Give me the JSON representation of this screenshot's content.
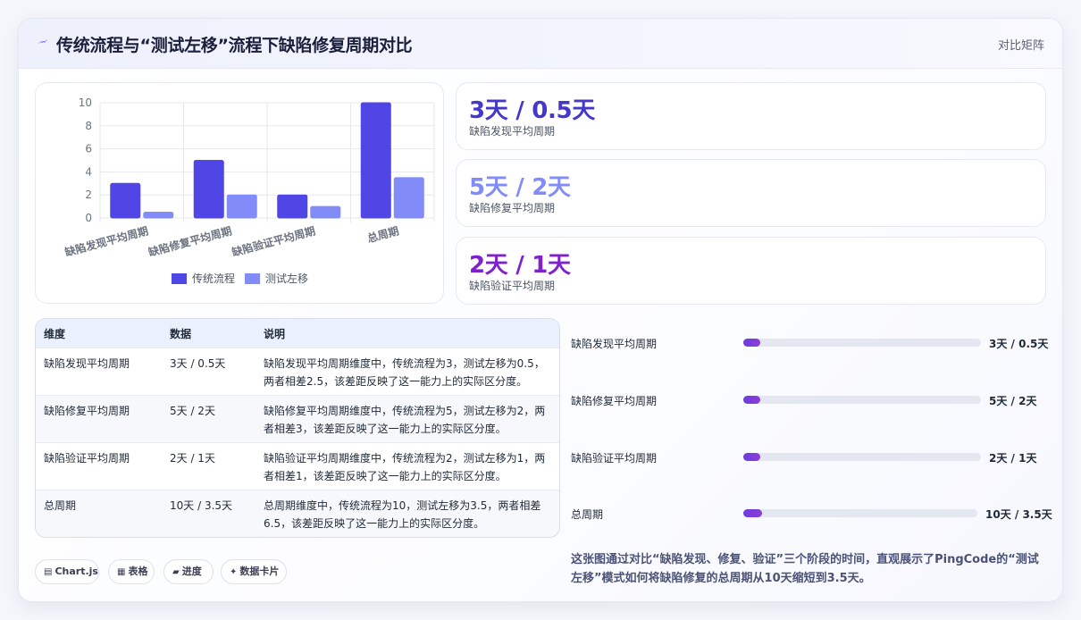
{
  "header": {
    "title": "传统流程与“测试左移”流程下缺陷修复周期对比",
    "tag": "对比矩阵",
    "logo_icon": "lightning-icon"
  },
  "chart_data": {
    "type": "bar",
    "categories": [
      "缺陷发现平均周期",
      "缺陷修复平均周期",
      "缺陷验证平均周期",
      "总周期"
    ],
    "series": [
      {
        "name": "传统流程",
        "values": [
          3,
          5,
          2,
          10
        ],
        "color": "#4f46e5"
      },
      {
        "name": "测试左移",
        "values": [
          0.5,
          2,
          1,
          3.5
        ],
        "color": "#818cf8"
      }
    ],
    "yticks": [
      "10",
      "8",
      "6",
      "4",
      "2",
      "0"
    ],
    "ylim": [
      0,
      10
    ],
    "legend": "bottom",
    "grid": true
  },
  "stats": [
    {
      "value": "3天 / 0.5天",
      "label": "缺陷发现平均周期",
      "color": "#4338ca"
    },
    {
      "value": "5天 / 2天",
      "label": "缺陷修复平均周期",
      "color": "#818cf8"
    },
    {
      "value": "2天 / 1天",
      "label": "缺陷验证平均周期",
      "color": "#7e22ce"
    }
  ],
  "table": {
    "headers": [
      "维度",
      "数据",
      "说明"
    ],
    "rows": [
      {
        "dim": "缺陷发现平均周期",
        "data": "3天 / 0.5天",
        "desc": "缺陷发现平均周期维度中，传统流程为3，测试左移为0.5，两者相差2.5，该差距反映了这一能力上的实际区分度。"
      },
      {
        "dim": "缺陷修复平均周期",
        "data": "5天 / 2天",
        "desc": "缺陷修复平均周期维度中，传统流程为5，测试左移为2，两者相差3，该差距反映了这一能力上的实际区分度。"
      },
      {
        "dim": "缺陷验证平均周期",
        "data": "2天 / 1天",
        "desc": "缺陷验证平均周期维度中，传统流程为2，测试左移为1，两者相差1，该差距反映了这一能力上的实际区分度。"
      },
      {
        "dim": "总周期",
        "data": "10天 / 3.5天",
        "desc": "总周期维度中，传统流程为10，测试左移为3.5，两者相差6.5，该差距反映了这一能力上的实际区分度。"
      }
    ]
  },
  "progress": [
    {
      "label": "缺陷发现平均周期",
      "value": "3天 / 0.5天",
      "fill_fraction": 0.07
    },
    {
      "label": "缺陷修复平均周期",
      "value": "5天 / 2天",
      "fill_fraction": 0.07
    },
    {
      "label": "缺陷验证平均周期",
      "value": "2天 / 1天",
      "fill_fraction": 0.07
    },
    {
      "label": "总周期",
      "value": "10天 / 3.5天",
      "fill_fraction": 0.08
    }
  ],
  "description": "这张图通过对比“缺陷发现、修复、验证”三个阶段的时间，直观展示了PingCode的“测试左移”模式如何将缺陷修复的总周期从10天缩短到3.5天。",
  "chips": [
    {
      "icon": "▤",
      "icon_name": "chart-icon",
      "label": "Chart.js"
    },
    {
      "icon": "▦",
      "icon_name": "table-icon",
      "label": "表格"
    },
    {
      "icon": "▰",
      "icon_name": "progress-icon",
      "label": "进度"
    },
    {
      "icon": "✦",
      "icon_name": "sparkle-icon",
      "label": "数据卡片"
    }
  ]
}
